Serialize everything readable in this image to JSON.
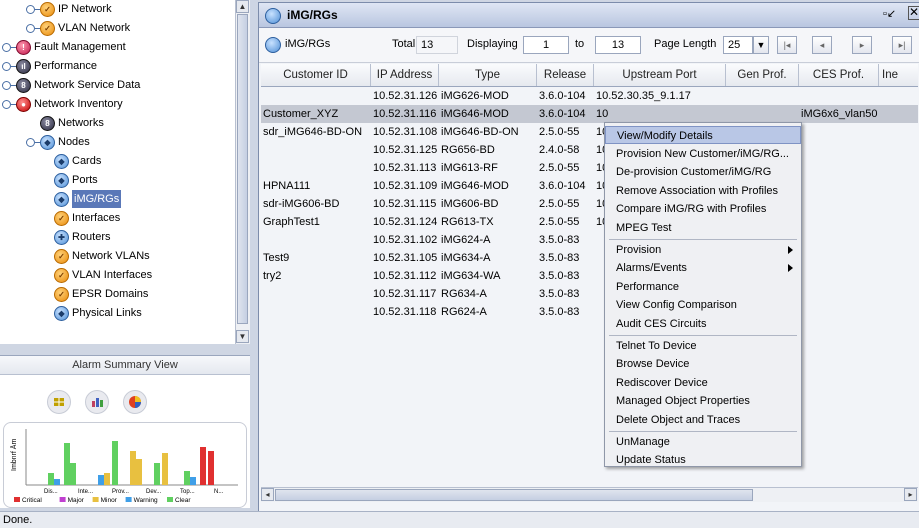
{
  "tree": {
    "items": [
      {
        "label": "IP Network",
        "icon": "orange-network-icon"
      },
      {
        "label": "VLAN Network",
        "icon": "orange-network-icon"
      },
      {
        "label": "Fault Management",
        "icon": "fault-management-icon"
      },
      {
        "label": "Performance",
        "icon": "performance-icon"
      },
      {
        "label": "Network Service Data",
        "icon": "service-data-icon"
      },
      {
        "label": "Network Inventory",
        "icon": "inventory-icon"
      },
      {
        "label": "Networks",
        "icon": "networks-icon"
      },
      {
        "label": "Nodes",
        "icon": "nodes-icon"
      },
      {
        "label": "Cards",
        "icon": "cards-icon"
      },
      {
        "label": "Ports",
        "icon": "ports-icon"
      },
      {
        "label": "iMG/RGs",
        "icon": "img-rg-icon",
        "selected": true
      },
      {
        "label": "Interfaces",
        "icon": "interfaces-icon"
      },
      {
        "label": "Routers",
        "icon": "routers-icon"
      },
      {
        "label": "Network VLANs",
        "icon": "network-vlans-icon"
      },
      {
        "label": "VLAN Interfaces",
        "icon": "vlan-interfaces-icon"
      },
      {
        "label": "EPSR Domains",
        "icon": "epsr-domains-icon"
      },
      {
        "label": "Physical Links",
        "icon": "physical-links-icon"
      }
    ]
  },
  "alarm_summary": {
    "title": "Alarm Summary View",
    "ylabel": "Imbnrf Ām",
    "categories": [
      "Dis...",
      "Inte...",
      "Prov...",
      "Dev...",
      "Top...",
      "N..."
    ],
    "legend": [
      "Critical",
      "Major",
      "Minor",
      "Warning",
      "Clear"
    ],
    "colors": {
      "Critical": "#e03030",
      "Major": "#c040d0",
      "Minor": "#e8c040",
      "Warning": "#3f9fe8",
      "Clear": "#60d060"
    }
  },
  "window": {
    "title": "iMG/RGs",
    "toolbar": {
      "name": "iMG/RGs",
      "total_label": "Total",
      "total_value": "13",
      "displaying_label": "Displaying",
      "from_value": "1",
      "to_label": "to",
      "to_value": "13",
      "page_length_label": "Page Length",
      "page_length_value": "25"
    },
    "columns": [
      "Customer ID",
      "IP Address",
      "Type",
      "Release",
      "Upstream Port",
      "Gen Prof.",
      "CES Prof.",
      "Ine"
    ],
    "rows": [
      {
        "customer": "",
        "ip": "10.52.31.126",
        "type": "iMG626-MOD",
        "release": "3.6.0-104",
        "upstream": "10.52.30.35_9.1.17",
        "gen": "",
        "ces": "",
        "selected": false
      },
      {
        "customer": "Customer_XYZ",
        "ip": "10.52.31.116",
        "type": "iMG646-MOD",
        "release": "3.6.0-104",
        "upstream": "10",
        "gen": "",
        "ces": "iMG6x6_vlan50",
        "selected": true
      },
      {
        "customer": "sdr_iMG646-BD-ON",
        "ip": "10.52.31.108",
        "type": "iMG646-BD-ON",
        "release": "2.5.0-55",
        "upstream": "10",
        "gen": "",
        "ces": "",
        "selected": false
      },
      {
        "customer": "",
        "ip": "10.52.31.125",
        "type": "RG656-BD",
        "release": "2.4.0-58",
        "upstream": "10",
        "gen": "",
        "ces": "",
        "selected": false
      },
      {
        "customer": "",
        "ip": "10.52.31.113",
        "type": "iMG613-RF",
        "release": "2.5.0-55",
        "upstream": "10",
        "gen": "",
        "ces": "",
        "selected": false
      },
      {
        "customer": "HPNA111",
        "ip": "10.52.31.109",
        "type": "iMG646-MOD",
        "release": "3.6.0-104",
        "upstream": "10",
        "gen": "",
        "ces": "",
        "selected": false
      },
      {
        "customer": "sdr-iMG606-BD",
        "ip": "10.52.31.115",
        "type": "iMG606-BD",
        "release": "2.5.0-55",
        "upstream": "10",
        "gen": "",
        "ces": "",
        "selected": false
      },
      {
        "customer": "GraphTest1",
        "ip": "10.52.31.124",
        "type": "RG613-TX",
        "release": "2.5.0-55",
        "upstream": "10",
        "gen": "",
        "ces": "",
        "selected": false
      },
      {
        "customer": "",
        "ip": "10.52.31.102",
        "type": "iMG624-A",
        "release": "3.5.0-83",
        "upstream": "",
        "gen": "",
        "ces": "",
        "selected": false
      },
      {
        "customer": "Test9",
        "ip": "10.52.31.105",
        "type": "iMG634-A",
        "release": "3.5.0-83",
        "upstream": "",
        "gen": "",
        "ces": "",
        "selected": false
      },
      {
        "customer": "try2",
        "ip": "10.52.31.112",
        "type": "iMG634-WA",
        "release": "3.5.0-83",
        "upstream": "",
        "gen": "",
        "ces": "",
        "selected": false
      },
      {
        "customer": "",
        "ip": "10.52.31.117",
        "type": "RG634-A",
        "release": "3.5.0-83",
        "upstream": "",
        "gen": "",
        "ces": "",
        "selected": false
      },
      {
        "customer": "",
        "ip": "10.52.31.118",
        "type": "RG624-A",
        "release": "3.5.0-83",
        "upstream": "",
        "gen": "",
        "ces": "",
        "selected": false
      }
    ]
  },
  "context_menu": {
    "items": [
      "View/Modify Details",
      "Provision New Customer/iMG/RG...",
      "De-provision Customer/iMG/RG",
      "Remove Association with Profiles",
      "Compare iMG/RG with Profiles",
      "MPEG Test",
      "Provision",
      "Alarms/Events",
      "Performance",
      "View Config Comparison",
      "Audit CES Circuits",
      "Telnet To Device",
      "Browse Device",
      "Rediscover Device",
      "Managed Object Properties",
      "Delete Object and Traces",
      "UnManage",
      "Update Status"
    ]
  },
  "status": "Done."
}
